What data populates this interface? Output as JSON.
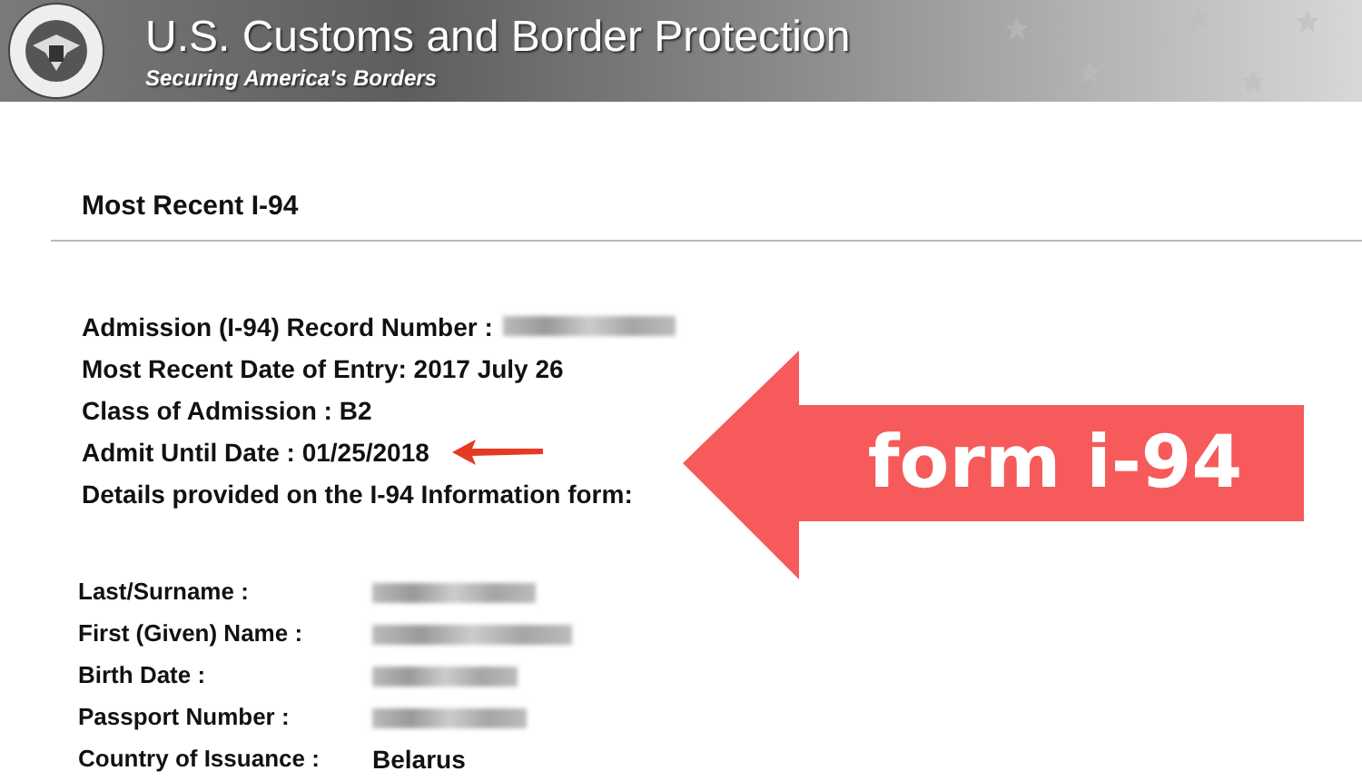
{
  "header": {
    "title": "U.S. Customs and Border Protection",
    "tagline": "Securing America's Borders"
  },
  "section": {
    "title": "Most Recent I-94"
  },
  "summary": [
    {
      "kind": "redacted",
      "label": "Admission (I-94) Record Number :",
      "pointer": false
    },
    {
      "kind": "text",
      "label": "Most Recent Date of Entry: 2017 July 26",
      "pointer": false
    },
    {
      "kind": "text",
      "label": "Class of Admission : B2",
      "pointer": false
    },
    {
      "kind": "text",
      "label": "Admit Until Date : 01/25/2018",
      "pointer": true
    },
    {
      "kind": "text",
      "label": "Details provided on the I-94 Information form:",
      "pointer": false
    }
  ],
  "details": [
    {
      "label": "Last/Surname :",
      "kind": "redacted"
    },
    {
      "label": "First (Given) Name :",
      "kind": "redacted"
    },
    {
      "label": "Birth Date :",
      "kind": "redacted"
    },
    {
      "label": "Passport Number :",
      "kind": "redacted"
    },
    {
      "label": "Country of Issuance :",
      "kind": "text",
      "value": "Belarus"
    }
  ],
  "callout": {
    "text": "form i-94"
  }
}
